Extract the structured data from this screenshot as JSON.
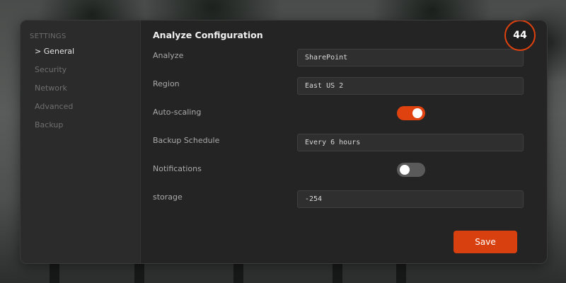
{
  "sidebar": {
    "title": "SETTINGS",
    "items": [
      {
        "label": "> General",
        "active": true
      },
      {
        "label": "Security",
        "active": false
      },
      {
        "label": "Network",
        "active": false
      },
      {
        "label": "Advanced",
        "active": false
      },
      {
        "label": "Backup",
        "active": false
      }
    ]
  },
  "main": {
    "title": "Analyze Configuration",
    "badge": "44",
    "fields": {
      "analyze": {
        "label": "Analyze",
        "value": "SharePoint"
      },
      "region": {
        "label": "Region",
        "value": "East US 2"
      },
      "auto_scaling": {
        "label": "Auto-scaling",
        "on": true
      },
      "backup_schedule": {
        "label": "Backup Schedule",
        "value": "Every 6 hours"
      },
      "notifications": {
        "label": "Notifications",
        "on": false
      },
      "storage": {
        "label": "storage",
        "value": "-254"
      }
    },
    "save_label": "Save"
  },
  "colors": {
    "accent": "#e0420f",
    "panel": "#242424",
    "sidebar": "#2b2b2b"
  }
}
